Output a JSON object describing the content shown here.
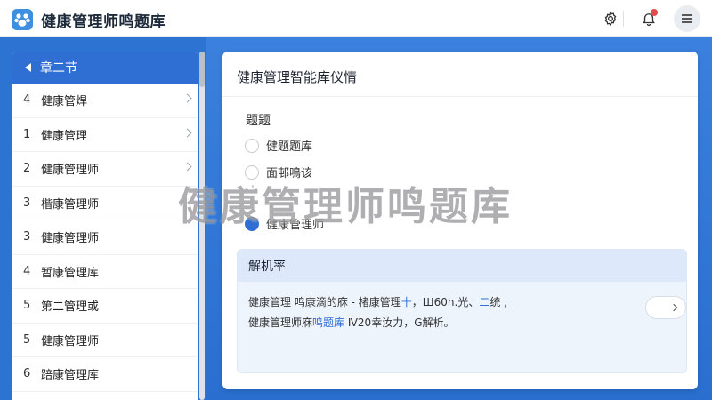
{
  "header": {
    "app_title": "健康管理师鸣题库",
    "logo_icon": "paw-logo-icon",
    "settings_icon": "gear-icon",
    "notifications_icon": "bell-icon",
    "menu_icon": "hamburger-icon",
    "notification_dot_color": "#e5484d"
  },
  "sidebar": {
    "header_label": "章二节",
    "items": [
      {
        "num": "4",
        "label": "健康管焊"
      },
      {
        "num": "1",
        "label": "健康管理"
      },
      {
        "num": "2",
        "label": "健康管理师"
      },
      {
        "num": "3",
        "label": "楷康管理师"
      },
      {
        "num": "3",
        "label": "健康管理师"
      },
      {
        "num": "4",
        "label": "暂康管理库"
      },
      {
        "num": "5",
        "label": "第二管理或"
      },
      {
        "num": "5",
        "label": "健康管理师"
      },
      {
        "num": "6",
        "label": "踣康管理库"
      }
    ]
  },
  "card": {
    "title": "健康管理智能库仪情",
    "section_label": "题题",
    "options": [
      {
        "label": "健题题库"
      },
      {
        "label": "面邨鳴该"
      },
      {
        "label": "健康管理师"
      }
    ],
    "faint_text": "- ˈ‑"
  },
  "info": {
    "heading": "解机率",
    "line1_a": "健康管理   鸣康滴的庥 - 楮康管理",
    "line1_hl": "十",
    "line1_b": "，Ш60h.光、",
    "line1_hl2": "二",
    "line1_c": "统 ,",
    "line2_a": "健康管理师庥",
    "line2_hl": "鸣题库",
    "line2_b": "   Ⅳ20幸汝力，G解析。"
  },
  "watermark": "健康管理师鸣题库",
  "colors": {
    "brand_blue": "#2f6fd3",
    "background_blue": "#2d73d2"
  }
}
